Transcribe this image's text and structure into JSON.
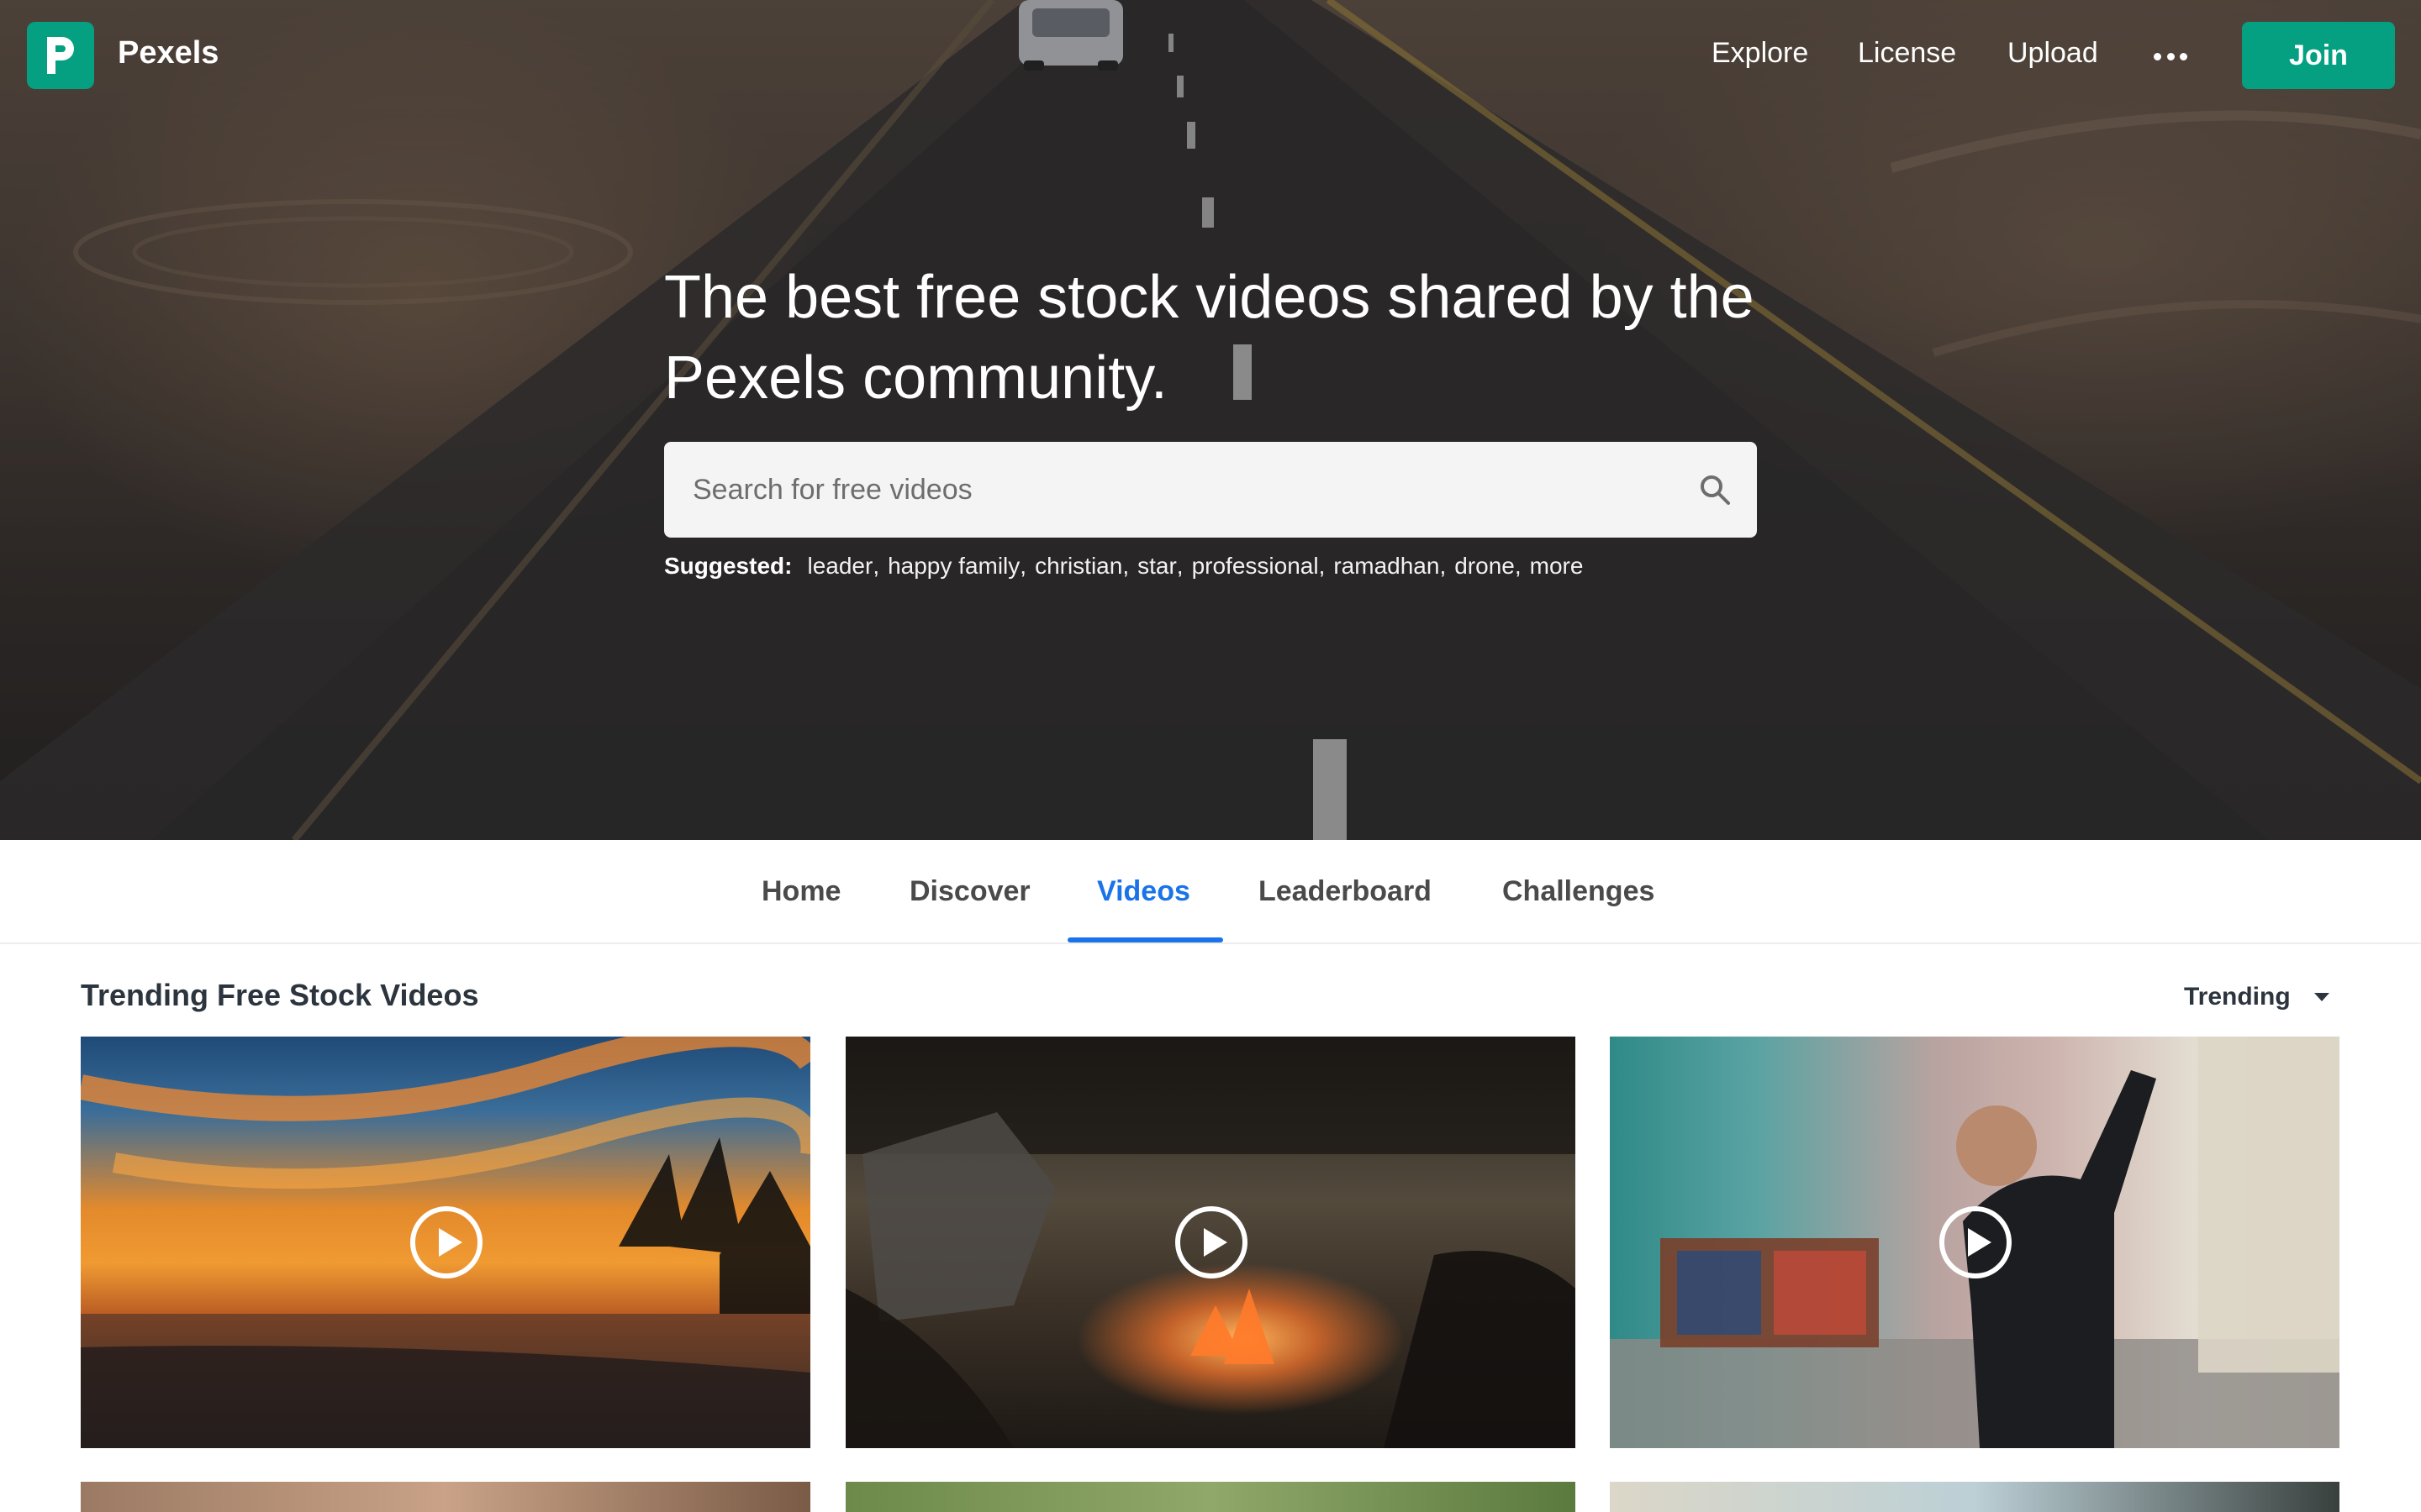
{
  "brand": {
    "name": "Pexels",
    "accent_color": "#05a081",
    "logo_icon": "pexels-logo-icon"
  },
  "nav": {
    "links": [
      {
        "label": "Explore"
      },
      {
        "label": "License"
      },
      {
        "label": "Upload"
      }
    ],
    "more_icon": "more-dots-icon",
    "join_label": "Join"
  },
  "hero": {
    "headline": "The best free stock videos shared by the Pexels community.",
    "search_placeholder": "Search for free videos",
    "search_icon": "search-icon",
    "suggested_label": "Suggested:",
    "suggested": [
      "leader",
      "happy family",
      "christian",
      "star",
      "professional",
      "ramadhan",
      "drone",
      "more"
    ]
  },
  "tabs": {
    "items": [
      "Home",
      "Discover",
      "Videos",
      "Leaderboard",
      "Challenges"
    ],
    "active": "Videos",
    "active_color": "#1a73e8"
  },
  "section": {
    "title": "Trending Free Stock Videos",
    "sort_value": "Trending"
  },
  "videos": [
    {
      "play_icon": "play-icon"
    },
    {
      "play_icon": "play-icon"
    },
    {
      "play_icon": "play-icon"
    }
  ]
}
